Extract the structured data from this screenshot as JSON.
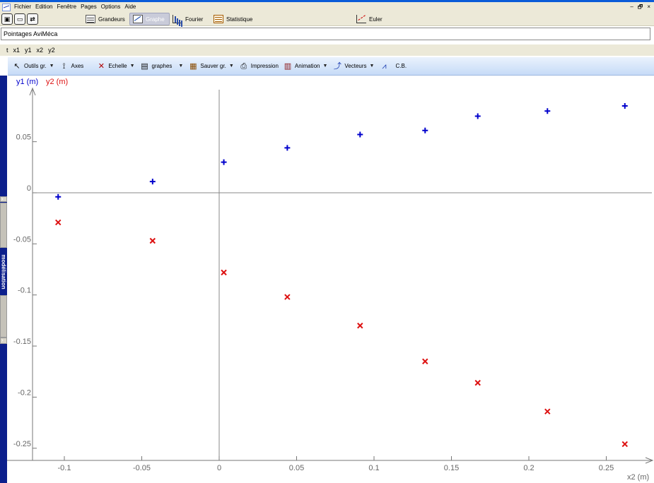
{
  "menu": {
    "items": [
      "Fichier",
      "Edition",
      "Fenêtre",
      "Pages",
      "Options",
      "Aide"
    ]
  },
  "window_controls": {
    "minimize": "–",
    "restore": "🗗",
    "close": "×"
  },
  "pages": {
    "grandeurs": "Grandeurs",
    "graphe": "Graphe",
    "fourier": "Fourier",
    "statistique": "Statistique",
    "euler": "Euler"
  },
  "document": {
    "title": "Pointages AviMéca"
  },
  "variables": [
    "t",
    "x1",
    "y1",
    "x2",
    "y2"
  ],
  "toolbar": {
    "outils": "Outils gr.",
    "axes": "Axes",
    "echelle": "Echelle",
    "graphes": "graphes",
    "sauver": "Sauver gr.",
    "impression": "Impression",
    "animation": "Animation",
    "vecteurs": "Vecteurs",
    "cb": "C.B."
  },
  "sidebar": {
    "modelisation": "modélisation"
  },
  "colors": {
    "series1": "#0000cc",
    "series2": "#dd1111",
    "toolbar_top": "#eaf2fd",
    "toolbar_bottom": "#c6dbf7",
    "side_strip": "#0c1f8c"
  },
  "chart_data": {
    "type": "scatter",
    "xlabel": "x2 (m)",
    "xlim": [
      -0.12,
      0.27
    ],
    "ylim": [
      -0.255,
      0.1
    ],
    "x_ticks": [
      -0.1,
      -0.05,
      0,
      0.05,
      0.1,
      0.15,
      0.2,
      0.25
    ],
    "x_tick_labels": [
      "-0.1",
      "-0.05",
      "0",
      "0.05",
      "0.1",
      "0.15",
      "0.2",
      "0.25"
    ],
    "y_ticks": [
      0.05,
      0,
      -0.05,
      -0.1,
      -0.15,
      -0.2,
      -0.25
    ],
    "y_tick_labels": [
      "0.05",
      "0",
      "-0.05",
      "-0.1",
      "-0.15",
      "-0.2",
      "-0.25"
    ],
    "grid": false,
    "x": [
      -0.104,
      -0.043,
      0.003,
      0.044,
      0.091,
      0.133,
      0.167,
      0.212,
      0.262
    ],
    "series": [
      {
        "name": "y1 (m)",
        "marker": "+",
        "color": "#0000cc",
        "values": [
          -0.004,
          0.011,
          0.03,
          0.044,
          0.057,
          0.061,
          0.075,
          0.08,
          0.085
        ]
      },
      {
        "name": "y2 (m)",
        "marker": "x",
        "color": "#dd1111",
        "values": [
          -0.029,
          -0.047,
          -0.078,
          -0.102,
          -0.13,
          -0.165,
          -0.186,
          -0.214,
          -0.246
        ]
      }
    ]
  }
}
